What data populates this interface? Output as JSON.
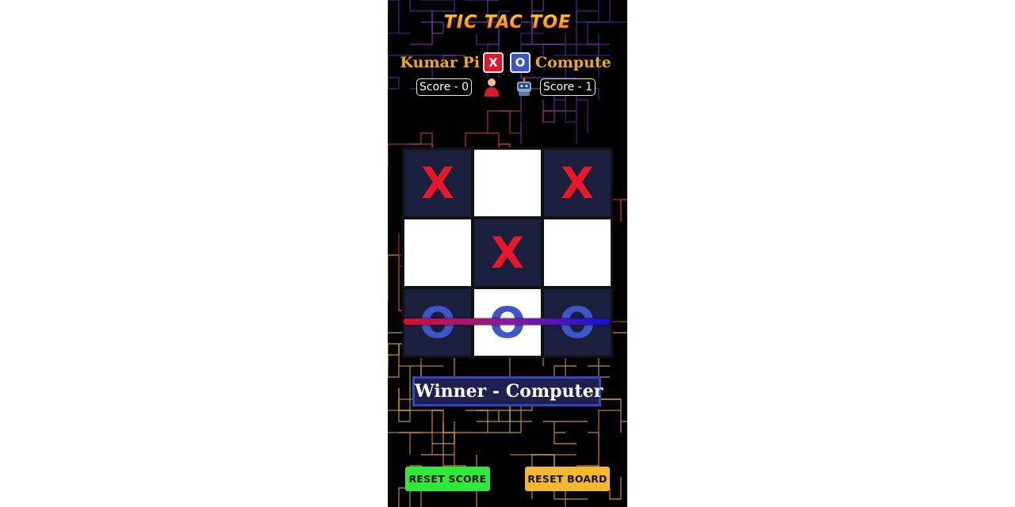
{
  "game": {
    "title": "TIC TAC TOE",
    "player1": {
      "name": "Kumar Pi",
      "mark": "X",
      "score_label": "Score - 0",
      "avatar_icon": "user-icon"
    },
    "player2": {
      "name": "Compute",
      "mark": "O",
      "score_label": "Score - 1",
      "avatar_icon": "robot-icon"
    },
    "board": [
      "X",
      "",
      "X",
      "",
      "X",
      "",
      "O",
      "O",
      "O"
    ],
    "winning_row": "bottom",
    "winner_text": "Winner - Computer",
    "buttons": {
      "reset_score": "RESET SCORE",
      "reset_board": "RESET BOARD"
    }
  },
  "colors": {
    "x_mark": "#e8182a",
    "o_mark": "#3f55c8",
    "reset_score_button": "#2ee83a",
    "reset_board_button": "#f2b830",
    "player_name": "#f0a820",
    "background": "#000000"
  }
}
